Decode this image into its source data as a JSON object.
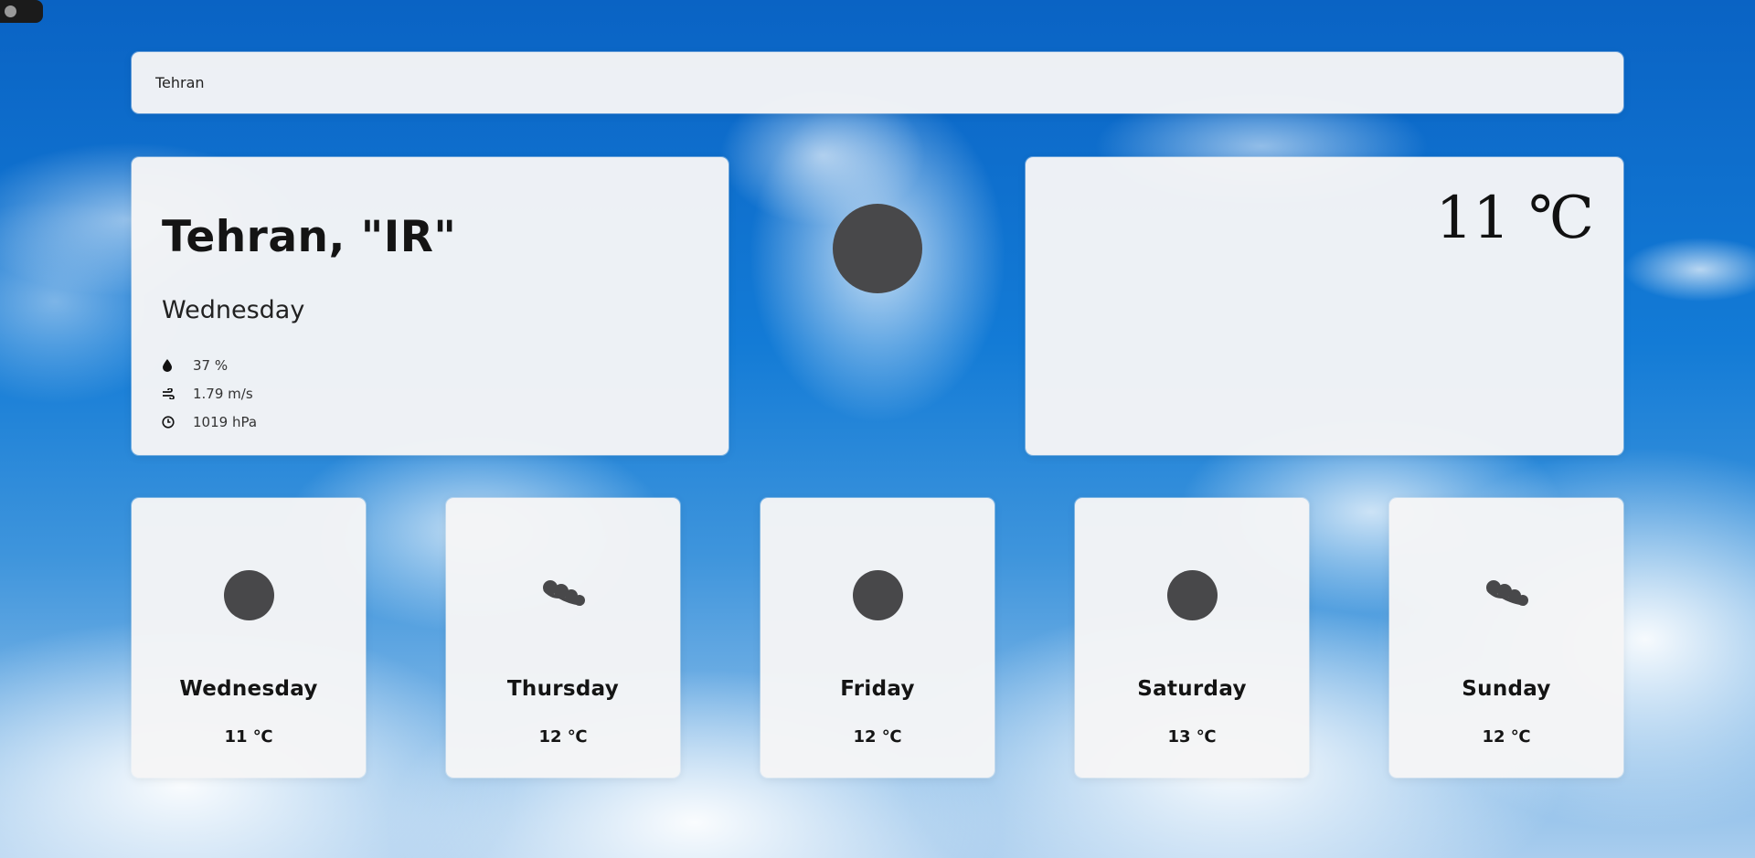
{
  "theme_toggle": {
    "state": "off"
  },
  "search": {
    "value": "Tehran"
  },
  "current": {
    "city": "Tehran, \"IR\"",
    "day": "Wednesday",
    "humidity": "37 %",
    "wind": "1.79 m/s",
    "pressure": "1019 hPa",
    "temperature": "11 ℃",
    "icon": "sun-icon"
  },
  "forecast": [
    {
      "day": "Wednesday",
      "temp": "11 ℃",
      "icon": "sun-icon"
    },
    {
      "day": "Thursday",
      "temp": "12 ℃",
      "icon": "clouds-icon"
    },
    {
      "day": "Friday",
      "temp": "12 ℃",
      "icon": "sun-icon"
    },
    {
      "day": "Saturday",
      "temp": "13 ℃",
      "icon": "sun-icon"
    },
    {
      "day": "Sunday",
      "temp": "12 ℃",
      "icon": "clouds-icon"
    }
  ],
  "colors": {
    "icon": "#48484a",
    "card": "#f5f5f6",
    "sky": "#137bd6"
  }
}
